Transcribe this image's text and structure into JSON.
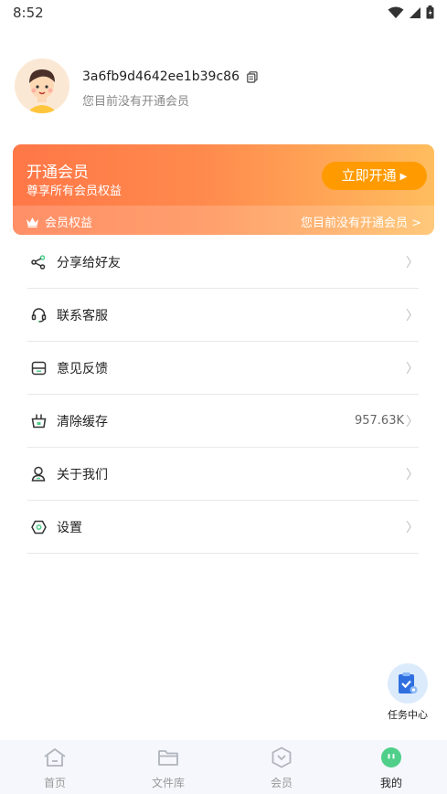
{
  "status_bar": {
    "time": "8:52"
  },
  "profile": {
    "user_id": "3a6fb9d4642ee1b39c86",
    "subtitle": "您目前没有开通会员"
  },
  "vip_card": {
    "title": "开通会员",
    "subtitle": "尊享所有会员权益",
    "button_label": "立即开通",
    "benefits_label": "会员权益",
    "status_link": "您目前没有开通会员 >",
    "colors": {
      "gradient_start": "#ff7747",
      "gradient_end": "#ffbd5e",
      "button": "#ff9b00"
    }
  },
  "menu": [
    {
      "label": "分享给好友",
      "icon": "share-icon",
      "value": "",
      "chevron": "〉"
    },
    {
      "label": "联系客服",
      "icon": "headset-icon",
      "value": "",
      "chevron": "〉"
    },
    {
      "label": "意见反馈",
      "icon": "feedback-icon",
      "value": "",
      "chevron": "〉"
    },
    {
      "label": "清除缓存",
      "icon": "basket-icon",
      "value": "957.63K",
      "chevron": "〉"
    },
    {
      "label": "关于我们",
      "icon": "person-icon",
      "value": "",
      "chevron": "〉"
    },
    {
      "label": "设置",
      "icon": "settings-icon",
      "value": "",
      "chevron": "〉"
    }
  ],
  "task_center": {
    "label": "任务中心",
    "icon": "clipboard-check-icon"
  },
  "tab_bar": [
    {
      "label": "首页",
      "icon": "home-icon",
      "active": false
    },
    {
      "label": "文件库",
      "icon": "folder-icon",
      "active": false
    },
    {
      "label": "会员",
      "icon": "vip-shield-icon",
      "active": false
    },
    {
      "label": "我的",
      "icon": "profile-face-icon",
      "active": true
    }
  ],
  "accent_color": "#4fcf8a"
}
